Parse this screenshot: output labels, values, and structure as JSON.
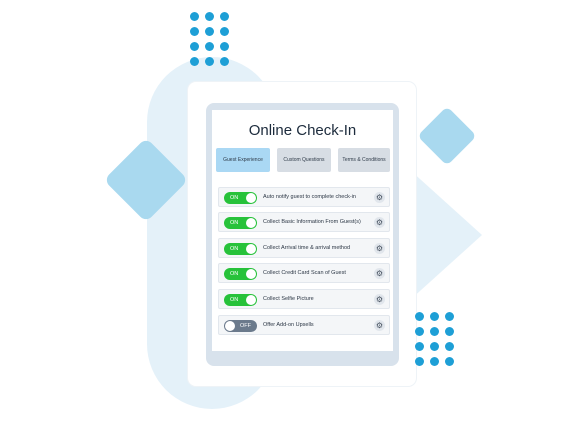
{
  "card": {
    "title": "Online Check-In"
  },
  "tabs": [
    {
      "label": "Guest Experience",
      "active": true
    },
    {
      "label": "Custom Questions",
      "active": false
    },
    {
      "label": "Terms & Conditions",
      "active": false
    }
  ],
  "options": [
    {
      "label": "Auto notify guest to complete check-in",
      "state": "ON"
    },
    {
      "label": "Collect Basic Information From Guest(s)",
      "state": "ON"
    },
    {
      "label": "Collect Arrival time & arrival method",
      "state": "ON"
    },
    {
      "label": "Collect Credit Card Scan of Guest",
      "state": "ON"
    },
    {
      "label": "Collect Selfie Picture",
      "state": "ON"
    },
    {
      "label": "Offer Add-on Upsells",
      "state": "OFF"
    }
  ],
  "icons": {
    "settings": "gear-icon",
    "settings_glyph": "⚙"
  },
  "colors": {
    "toggle_on": "#27c23a",
    "toggle_off": "#6b7a8c",
    "active_tab": "#aad8f4",
    "accent_dots": "#1e9fd6"
  }
}
